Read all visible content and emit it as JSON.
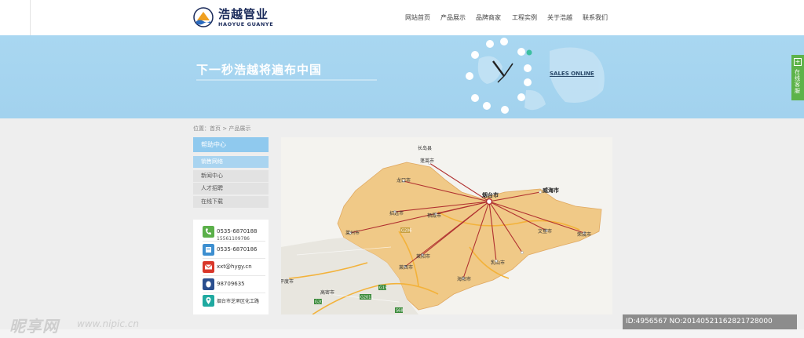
{
  "header": {
    "logo_cn": "浩越管业",
    "logo_en": "HAOYUE GUANYE",
    "nav": [
      "网站首页",
      "产品展示",
      "品牌商家",
      "工程实例",
      "关于浩越",
      "联系我们"
    ]
  },
  "banner": {
    "title": "下一秒浩越将遍布中国",
    "sales_link": "SALES ONLINE"
  },
  "side_tab": {
    "label": "在线客服"
  },
  "breadcrumb": "位置：首页 > 产品展示",
  "sidebar": {
    "title": "帮助中心",
    "items": [
      {
        "label": "销售网络",
        "active": true
      },
      {
        "label": "新闻中心",
        "active": false
      },
      {
        "label": "人才招聘",
        "active": false
      },
      {
        "label": "在线下载",
        "active": false
      }
    ]
  },
  "contact": {
    "phone": "0535-6870188",
    "mobile": "15561109786",
    "fax": "0535-6870186",
    "email": "xxt@hygy.cn",
    "qq": "98709635",
    "address": "烟台市芝罘区化工路"
  },
  "map": {
    "center": "烟台市",
    "cities": [
      "长岛县",
      "蓬莱市",
      "龙口市",
      "招远市",
      "栖霞市",
      "莱州市",
      "莱阳市",
      "海阳市",
      "乳山市",
      "文登市",
      "荣成市",
      "莱西市",
      "威海市",
      "平度市",
      "高密市"
    ],
    "roads": [
      "G15",
      "G20",
      "G2011",
      "S68",
      "G206"
    ]
  },
  "watermark": {
    "brand": "昵享网",
    "url": "www.nipic.cn",
    "id": "ID:4956567 NO:20140521162821728000"
  },
  "colors": {
    "banner": "#a9d7f1",
    "accent_blue": "#8fc9ee",
    "side_tab": "#5db34a",
    "map_land": "#f0c987",
    "route": "#b03030"
  }
}
